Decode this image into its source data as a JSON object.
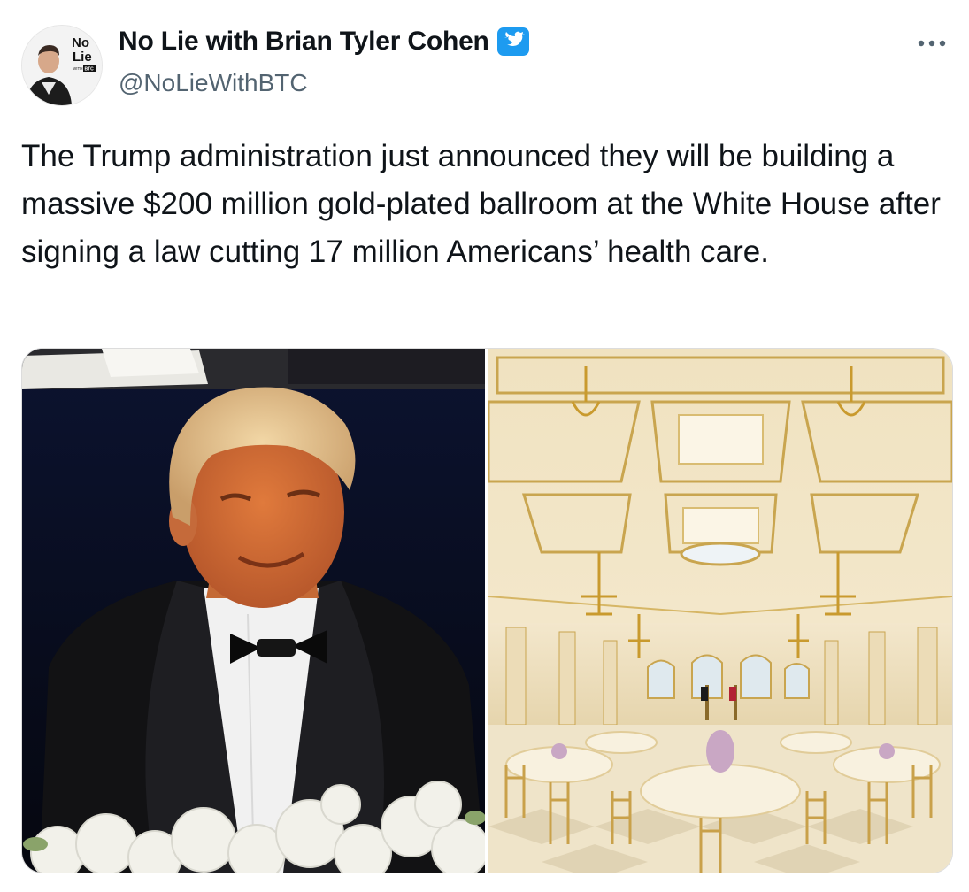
{
  "tweet": {
    "author": {
      "display_name": "No Lie with Brian Tyler Cohen",
      "handle": "@NoLieWithBTC",
      "verified": true,
      "avatar_text_line1": "No",
      "avatar_text_line2": "Lie",
      "avatar_text_small": "WITH",
      "avatar_text_badge": "BTC"
    },
    "text": "The Trump administration just announced they will be building a massive $200 million gold-plated ballroom at the White House after signing a law cutting 17 million Americans’ health care.",
    "media": [
      {
        "icon": "portrait-photo"
      },
      {
        "icon": "ballroom-rendering-photo"
      }
    ]
  },
  "colors": {
    "verified_blue": "#1d9bf0",
    "handle_gray": "#536471",
    "text": "#0f1419"
  }
}
